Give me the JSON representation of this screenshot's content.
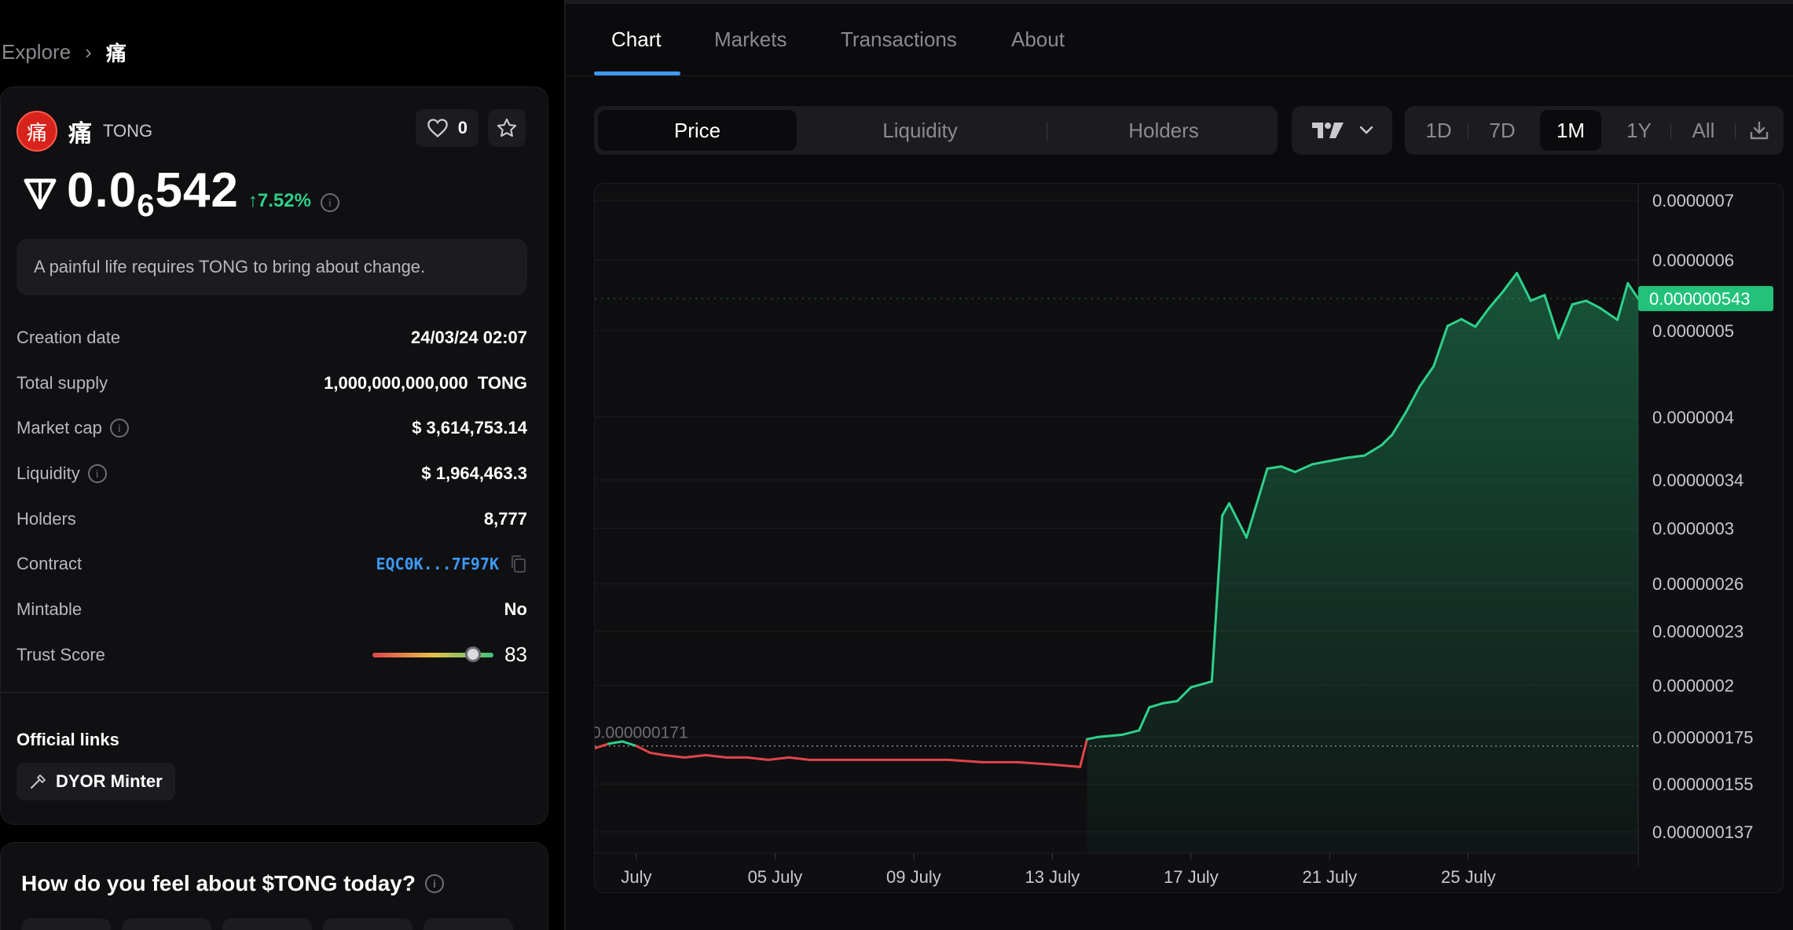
{
  "breadcrumb": {
    "root": "Explore",
    "current": "痛"
  },
  "token": {
    "logo_glyph": "痛",
    "name": "痛",
    "symbol": "TONG",
    "likes": "0",
    "price_prefix": "0.0",
    "price_zeros": "6",
    "price_digits": "542",
    "price_change": "↑7.52%",
    "description": "A painful life requires TONG to bring about change."
  },
  "stats": {
    "creation_date_label": "Creation date",
    "creation_date": "24/03/24 02:07",
    "total_supply_label": "Total supply",
    "total_supply": "1,000,000,000,000  TONG",
    "market_cap_label": "Market cap",
    "market_cap": "$ 3,614,753.14",
    "liquidity_label": "Liquidity",
    "liquidity": "$ 1,964,463.3",
    "holders_label": "Holders",
    "holders": "8,777",
    "contract_label": "Contract",
    "contract": "EQC0K...7F97K",
    "mintable_label": "Mintable",
    "mintable": "No",
    "trust_label": "Trust Score",
    "trust_score": 83
  },
  "links": {
    "title": "Official links",
    "dyor_label": "DYOR Minter"
  },
  "feel": {
    "title": "How do you feel about $TONG today?"
  },
  "tabs": [
    "Chart",
    "Markets",
    "Transactions",
    "About"
  ],
  "segments": [
    "Price",
    "Liquidity",
    "Holders"
  ],
  "ranges": [
    "1D",
    "7D",
    "1M",
    "1Y",
    "All"
  ],
  "colors": {
    "up": "#2fd08a",
    "down": "#e0454a",
    "accent": "#3d9af7"
  },
  "chart_data": {
    "type": "line",
    "y_scale": "log",
    "ylim": [
      1.28e-07,
      7.2e-07
    ],
    "y_ticks": [
      "0.0000007",
      "0.0000006",
      "0.0000005",
      "0.0000004",
      "0.00000034",
      "0.0000003",
      "0.00000026",
      "0.00000023",
      "0.0000002",
      "0.000000175",
      "0.000000155",
      "0.000000137"
    ],
    "x_ticks": [
      "July",
      "05 July",
      "09 July",
      "13 July",
      "17 July",
      "21 July",
      "25 July"
    ],
    "x_tick_days": [
      1,
      5,
      9,
      13,
      17,
      21,
      25
    ],
    "xlim": [
      -0.2,
      29.9
    ],
    "reference_label": "0.000000171",
    "reference_value": 1.71e-07,
    "last_price_label": "0.000000543",
    "last_price": 5.43e-07,
    "series": [
      {
        "x": [
          -0.2,
          0.2,
          0.6,
          1.0,
          1.4,
          1.8,
          2.4,
          3.0,
          3.6,
          4.2,
          4.8,
          5.4,
          6.0,
          7.0,
          8.0,
          9.0,
          10.0,
          11.0,
          12.0,
          13.0,
          13.8,
          14.0,
          14.3,
          15.0,
          15.5,
          15.8,
          16.2,
          16.6,
          17.0,
          17.6,
          17.9,
          18.1,
          18.6,
          19.2,
          19.6,
          20.0,
          20.5,
          21.0,
          21.5,
          22.0,
          22.5,
          22.8,
          23.2,
          23.6,
          24.0,
          24.4,
          24.8,
          25.2,
          25.6,
          26.0,
          26.4,
          26.8,
          27.2,
          27.6,
          28.0,
          28.4,
          28.8,
          29.3,
          29.6,
          29.9
        ],
        "y": [
          1.7e-07,
          1.72e-07,
          1.73e-07,
          1.71e-07,
          1.68e-07,
          1.67e-07,
          1.66e-07,
          1.67e-07,
          1.66e-07,
          1.66e-07,
          1.65e-07,
          1.66e-07,
          1.65e-07,
          1.65e-07,
          1.65e-07,
          1.65e-07,
          1.65e-07,
          1.64e-07,
          1.64e-07,
          1.63e-07,
          1.62e-07,
          1.74e-07,
          1.75e-07,
          1.76e-07,
          1.78e-07,
          1.89e-07,
          1.91e-07,
          1.92e-07,
          1.99e-07,
          2.02e-07,
          3.1e-07,
          3.2e-07,
          2.93e-07,
          3.5e-07,
          3.52e-07,
          3.47e-07,
          3.54e-07,
          3.57e-07,
          3.6e-07,
          3.62e-07,
          3.72e-07,
          3.82e-07,
          4.05e-07,
          4.33e-07,
          4.56e-07,
          5.06e-07,
          5.15e-07,
          5.05e-07,
          5.3e-07,
          5.53e-07,
          5.8e-07,
          5.4e-07,
          5.48e-07,
          4.9e-07,
          5.35e-07,
          5.4e-07,
          5.3e-07,
          5.14e-07,
          5.65e-07,
          5.43e-07
        ]
      }
    ]
  }
}
